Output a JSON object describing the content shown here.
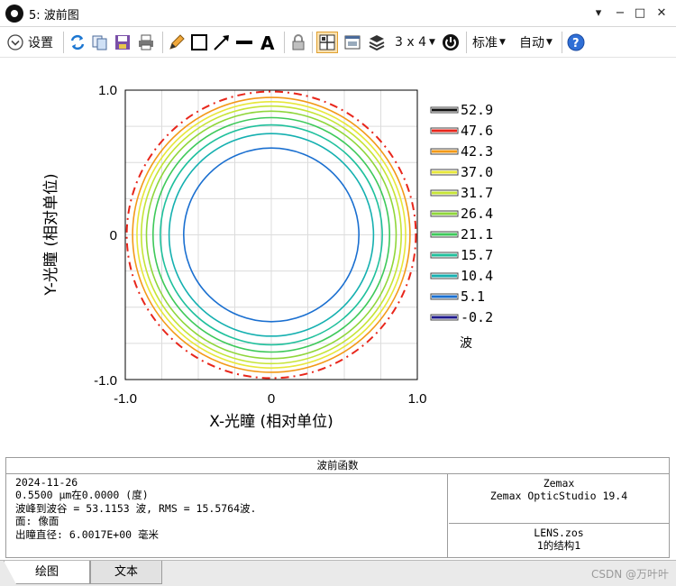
{
  "window": {
    "title": "5: 波前图",
    "controls": [
      "▾",
      "−",
      "□",
      "✕"
    ]
  },
  "toolbar": {
    "settings_label": "设置",
    "grid_label": "3 x 4",
    "standard_label": "标准",
    "auto_label": "自动"
  },
  "chart_data": {
    "type": "contour",
    "xlabel": "X-光瞳 (相对单位)",
    "ylabel": "Y-光瞳 (相对单位)",
    "xlim": [
      -1.0,
      1.0
    ],
    "ylim": [
      -1.0,
      1.0
    ],
    "x_ticks": [
      "-1.0",
      "0",
      "1.0"
    ],
    "y_ticks": [
      "1.0",
      "0",
      "-1.0"
    ],
    "grid": true,
    "legend_unit": "波",
    "legend": [
      {
        "value": "52.9",
        "color": "#111111"
      },
      {
        "value": "47.6",
        "color": "#e8261b"
      },
      {
        "value": "42.3",
        "color": "#f29a18"
      },
      {
        "value": "37.0",
        "color": "#e7e73a"
      },
      {
        "value": "31.7",
        "color": "#c6e436"
      },
      {
        "value": "26.4",
        "color": "#8fd63a"
      },
      {
        "value": "21.1",
        "color": "#3ec95a"
      },
      {
        "value": "15.7",
        "color": "#1fc09c"
      },
      {
        "value": "10.4",
        "color": "#15b0b0"
      },
      {
        "value": "5.1",
        "color": "#1a6fd0"
      },
      {
        "value": "-0.2",
        "color": "#1f1a8c"
      }
    ],
    "contours": [
      {
        "radius": 0.6,
        "color": "#1a6fd0"
      },
      {
        "radius": 0.7,
        "color": "#15b0b0"
      },
      {
        "radius": 0.76,
        "color": "#1fc09c"
      },
      {
        "radius": 0.81,
        "color": "#3ec95a"
      },
      {
        "radius": 0.855,
        "color": "#8fd63a"
      },
      {
        "radius": 0.89,
        "color": "#c6e436"
      },
      {
        "radius": 0.92,
        "color": "#e7e73a"
      },
      {
        "radius": 0.95,
        "color": "#f29a18"
      }
    ],
    "boundary": {
      "radius": 0.99,
      "color": "#e8261b",
      "style": "dashed"
    }
  },
  "info": {
    "title": "波前函数",
    "lines": [
      "2024-11-26",
      "0.5500 µm在0.0000 (度)",
      "波峰到波谷 = 53.1153 波, RMS = 15.5764波.",
      "面: 像面",
      "出瞳直径: 6.0017E+00 毫米"
    ],
    "right_top": [
      "Zemax",
      "Zemax OpticStudio 19.4"
    ],
    "right_bottom": [
      "LENS.zos",
      "1的结构1"
    ]
  },
  "tabs": {
    "plot": "绘图",
    "text": "文本"
  },
  "watermark": "CSDN @万叶叶"
}
